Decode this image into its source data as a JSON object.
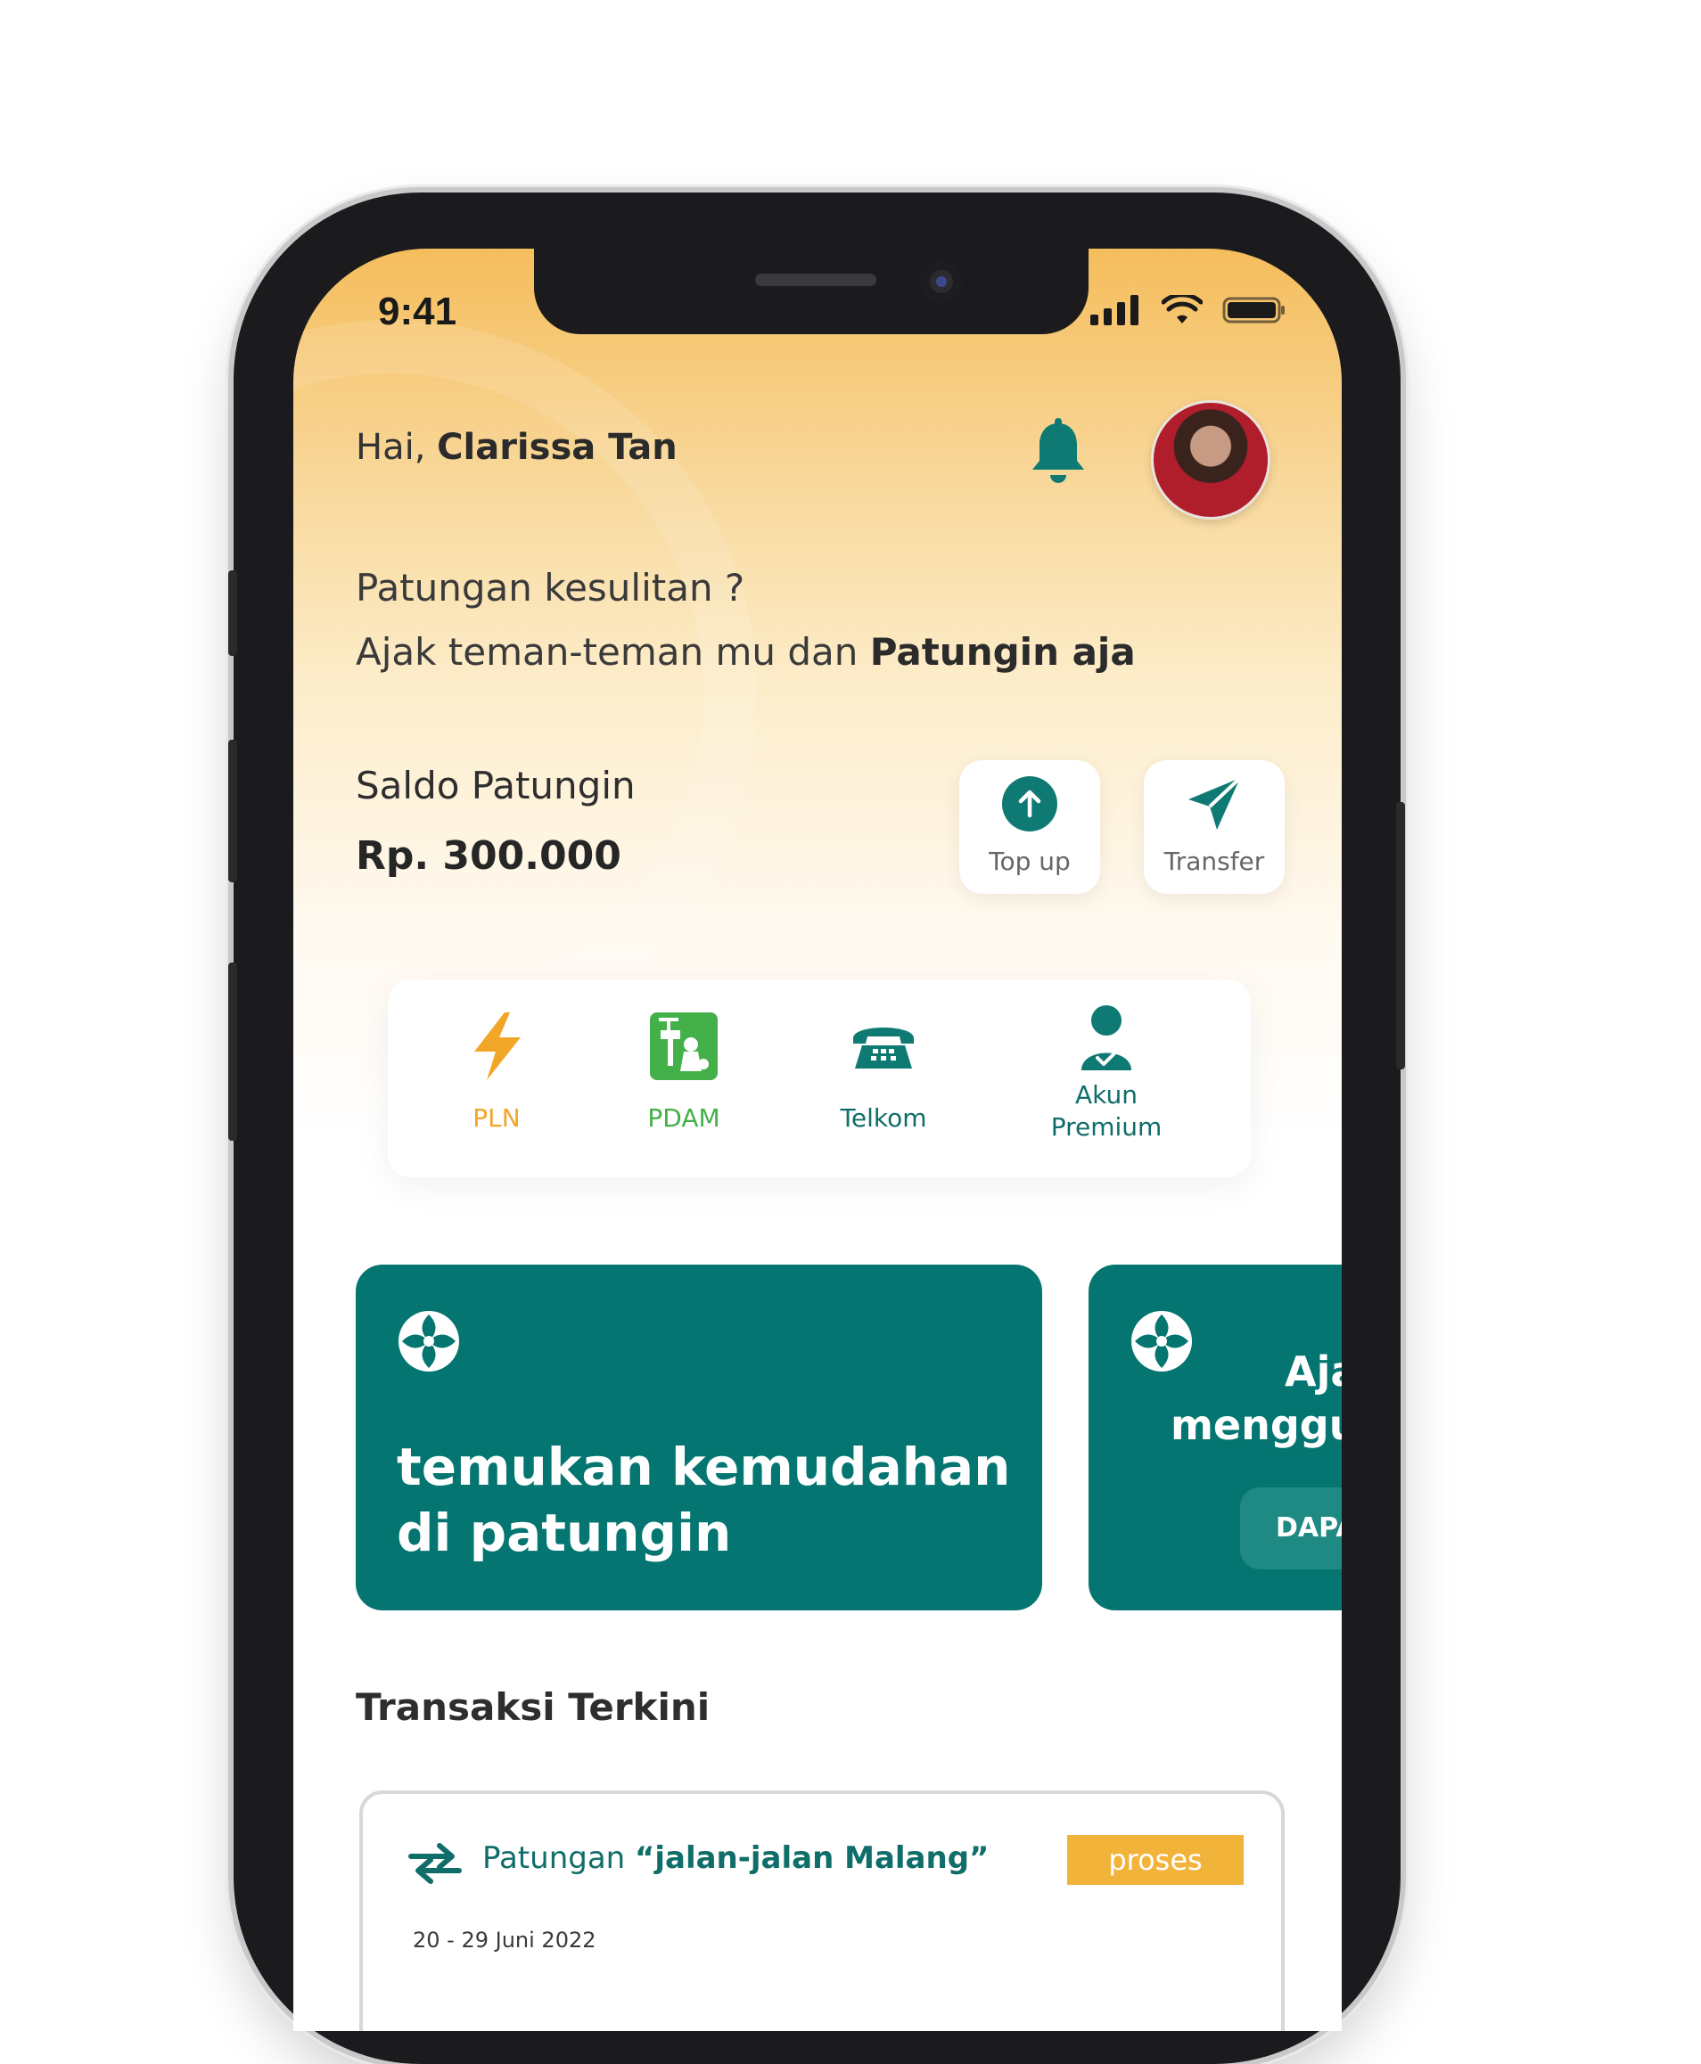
{
  "status_bar": {
    "time": "9:41"
  },
  "header": {
    "greeting_prefix": "Hai, ",
    "user_name": "Clarissa Tan"
  },
  "tagline": {
    "line1": "Patungan kesulitan ?",
    "line2_prefix": "Ajak teman-teman mu dan ",
    "line2_bold": "Patungin aja"
  },
  "balance": {
    "label": "Saldo Patungin",
    "value": "Rp. 300.000"
  },
  "quick_actions": {
    "topup_label": "Top up",
    "transfer_label": "Transfer"
  },
  "services": [
    {
      "label": "PLN",
      "icon": "lightning-icon",
      "color": "#f2a627"
    },
    {
      "label": "PDAM",
      "icon": "water-tap-icon",
      "color": "#43b049"
    },
    {
      "label": "Telkom",
      "icon": "telephone-icon",
      "color": "#0f6e69"
    },
    {
      "label": "Akun\nPremium",
      "icon": "user-check-icon",
      "color": "#0f6e69"
    }
  ],
  "promos": [
    {
      "text_line1": "temukan kemudahan",
      "text_line2": "di patungin"
    },
    {
      "text_line1": "Aja",
      "text_line2": "menggu",
      "button_label": "DAPAT"
    }
  ],
  "recent": {
    "title": "Transaksi Terkini",
    "transactions": [
      {
        "title_prefix": "Patungan ",
        "title_bold": "“jalan-jalan Malang”",
        "status": "proses",
        "date": "20 - 29 Juni 2022"
      }
    ]
  },
  "colors": {
    "primary": "#047570",
    "accent": "#f2b33b",
    "header_gradient_top": "#f5bd5c"
  }
}
